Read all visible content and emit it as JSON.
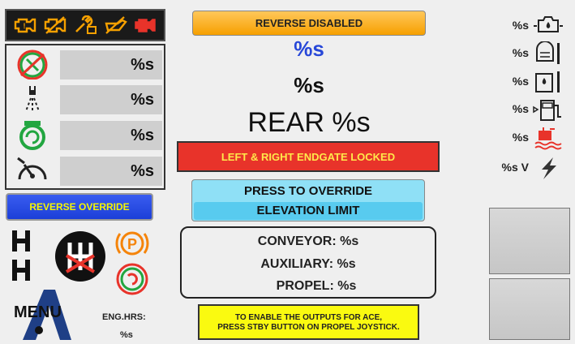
{
  "header": {
    "reverse_disabled": "REVERSE DISABLED"
  },
  "center": {
    "blue_value": "%s",
    "black_value": "%s",
    "rear_value": "REAR %s",
    "endgate_banner": "LEFT & RIGHT ENDGATE LOCKED",
    "override_line1": "PRESS TO OVERRIDE",
    "override_line2": "ELEVATION LIMIT",
    "conveyor": "CONVEYOR: %s",
    "auxiliary": "AUXILIARY: %s",
    "propel": "PROPEL: %s",
    "note_line1": "TO ENABLE THE OUTPUTS FOR ACE,",
    "note_line2": "PRESS STBY BUTTON ON PROPEL JOYSTICK."
  },
  "left_panel": {
    "rows": [
      {
        "icon": "blocked-fan-icon",
        "value": "%s"
      },
      {
        "icon": "spray-nozzle-icon",
        "value": "%s"
      },
      {
        "icon": "pump-icon",
        "value": "%s"
      },
      {
        "icon": "speedometer-icon",
        "value": "%s"
      }
    ],
    "reverse_override": "REVERSE OVERRIDE"
  },
  "bottom_left": {
    "menu": "MENU",
    "eng_hrs_label": "ENG.HRS:",
    "eng_hrs_value": "%s"
  },
  "right_column": {
    "rows": [
      {
        "icon": "oil-pressure-icon",
        "value": "%s"
      },
      {
        "icon": "coolant-temp-icon",
        "value": "%s"
      },
      {
        "icon": "hydraulic-temp-icon",
        "value": "%s"
      },
      {
        "icon": "fuel-icon",
        "value": "%s"
      },
      {
        "icon": "hydraulic-level-icon",
        "value": "%s"
      },
      {
        "icon": "voltage-icon",
        "value": "%s V"
      }
    ]
  },
  "colors": {
    "amber": "#f6a000",
    "red_banner": "#e8332a",
    "cyan_button": "#8fe0f6",
    "blue_button": "#1b3fd8",
    "yellow_note": "#fafa10",
    "warning_orange": "#f5a000",
    "warning_red": "#e8332a"
  },
  "warning_icons": [
    "engine-warning-icon",
    "engine-fault-icon",
    "wrench-icon",
    "oil-can-icon",
    "check-engine-icon"
  ]
}
